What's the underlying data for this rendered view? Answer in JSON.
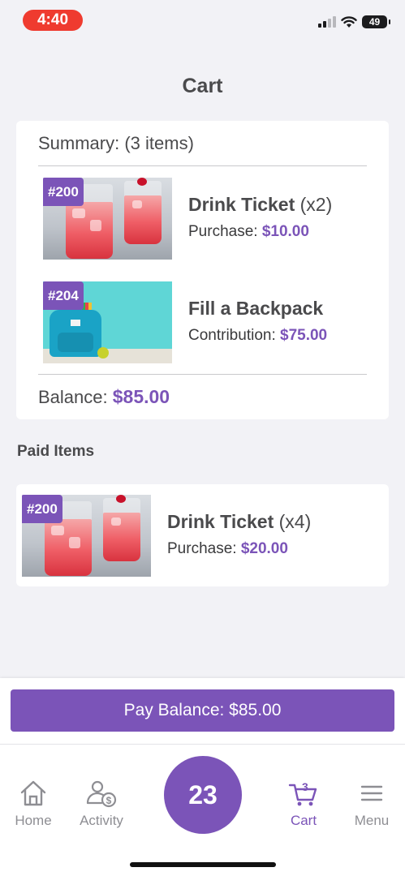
{
  "status_bar": {
    "time": "4:40",
    "battery": "49"
  },
  "page": {
    "title": "Cart"
  },
  "summary": {
    "heading": "Summary: (3 items)",
    "items": [
      {
        "badge": "#200",
        "name": "Drink Ticket",
        "qty": "(x2)",
        "sub_label": "Purchase:",
        "amount": "$10.00",
        "image": "drinks-image"
      },
      {
        "badge": "#204",
        "name": "Fill a Backpack",
        "qty": "",
        "sub_label": "Contribution:",
        "amount": "$75.00",
        "image": "backpack-image"
      }
    ],
    "balance_label": "Balance:",
    "balance_amount": "$85.00"
  },
  "paid": {
    "title": "Paid Items",
    "items": [
      {
        "badge": "#200",
        "name": "Drink Ticket",
        "qty": "(x4)",
        "sub_label": "Purchase:",
        "amount": "$20.00",
        "image": "drinks-image"
      }
    ]
  },
  "pay_button": {
    "label": "Pay Balance: $85.00"
  },
  "tab_bar": {
    "home": "Home",
    "activity": "Activity",
    "center_number": "23",
    "cart": "Cart",
    "cart_count": "3",
    "menu": "Menu"
  },
  "colors": {
    "accent": "#7b54b8",
    "status_time_bg": "#ef3b2f",
    "background": "#f2f2f6"
  },
  "icons": [
    "signal-icon",
    "wifi-icon",
    "battery-icon",
    "home-icon",
    "activity-icon",
    "cart-icon",
    "menu-icon"
  ]
}
